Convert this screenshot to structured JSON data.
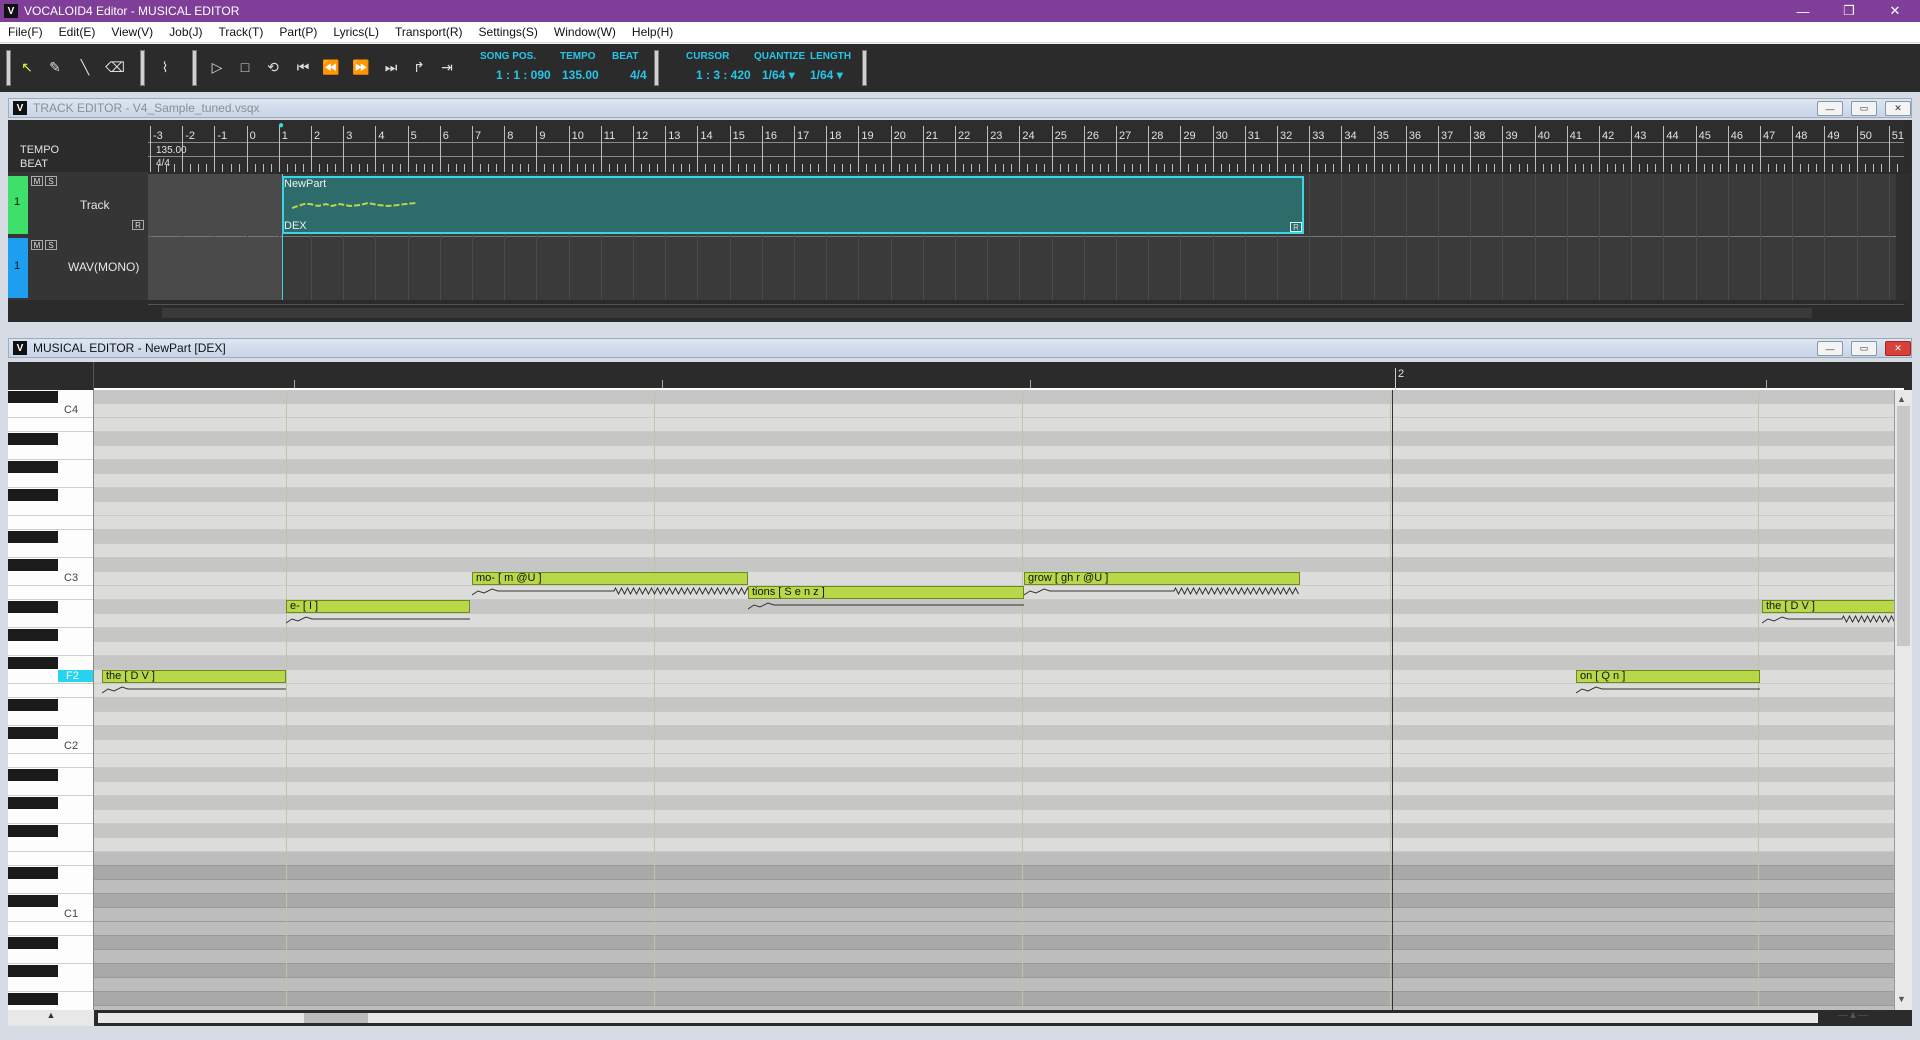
{
  "window": {
    "title": "VOCALOID4 Editor - MUSICAL EDITOR",
    "logo": "V",
    "controls": [
      "minimize-icon",
      "restore-icon",
      "close-icon"
    ]
  },
  "menu": [
    "File(F)",
    "Edit(E)",
    "View(V)",
    "Job(J)",
    "Track(T)",
    "Part(P)",
    "Lyrics(L)",
    "Transport(R)",
    "Settings(S)",
    "Window(W)",
    "Help(H)"
  ],
  "toolbar": {
    "tools": [
      "arrow-tool-icon",
      "pencil-tool-icon",
      "line-tool-icon",
      "eraser-tool-icon",
      "curve-tool-icon"
    ],
    "transport": [
      "play-icon",
      "stop-icon",
      "loop-icon",
      "start-icon",
      "rewind-icon",
      "forward-icon",
      "end-icon",
      "start-marker-icon",
      "end-marker-icon"
    ],
    "song_pos_label": "SONG POS.",
    "song_pos": "1 : 1 : 090",
    "tempo_label": "TEMPO",
    "tempo": "135.00",
    "beat_label": "BEAT",
    "beat": "4/4",
    "cursor_label": "CURSOR",
    "cursor": "1 : 3 : 420",
    "quantize_label": "QUANTIZE",
    "quantize": "1/64 ▾",
    "length_label": "LENGTH",
    "length": "1/64 ▾",
    "accent": "#26c6e8"
  },
  "track_editor": {
    "title": "TRACK EDITOR - V4_Sample_tuned.vsqx",
    "tempo_label": "TEMPO",
    "tempo_value": "135.00",
    "beat_label": "BEAT",
    "beat_value": "4/4",
    "measures": [
      "-3",
      "-2",
      "-1",
      "0",
      "1",
      "2",
      "3",
      "4",
      "5",
      "6",
      "7",
      "8",
      "9",
      "10",
      "11",
      "12",
      "13",
      "14",
      "15",
      "16",
      "17",
      "18",
      "19",
      "20",
      "21",
      "22",
      "23",
      "24",
      "25",
      "26",
      "27",
      "28",
      "29",
      "30",
      "31",
      "32",
      "33",
      "34",
      "35",
      "36",
      "37",
      "38",
      "39",
      "40",
      "41",
      "42",
      "43",
      "44",
      "45",
      "46",
      "47",
      "48",
      "49",
      "50",
      "51"
    ],
    "tracks": [
      {
        "num": "1",
        "name": "Track",
        "color": "#3fe06a",
        "m": "M",
        "s": "S"
      },
      {
        "num": "1",
        "name": "WAV(MONO)",
        "color": "#1e9ef0",
        "m": "M",
        "s": "S"
      }
    ],
    "part": {
      "name": "NewPart",
      "singer": "DEX",
      "r": "R",
      "color": "#2e6b6b",
      "border": "#3ad6e6"
    }
  },
  "musical_editor": {
    "title": "MUSICAL EDITOR - NewPart [DEX]",
    "measure_marker": "2",
    "key_labels": [
      {
        "text": "C4"
      },
      {
        "text": "C3"
      },
      {
        "text": "F2",
        "highlight": true
      },
      {
        "text": "C2"
      },
      {
        "text": "C1"
      }
    ],
    "notes": [
      {
        "lyric": "the [ D V ]"
      },
      {
        "lyric": "e- [ I ]"
      },
      {
        "lyric": "mo- [ m @U ]"
      },
      {
        "lyric": "tions [ S e n z ]"
      },
      {
        "lyric": "grow [ gh r @U ]"
      },
      {
        "lyric": "on [ Q n ]"
      },
      {
        "lyric": "the [ D V ]"
      }
    ],
    "note_color": "#b8d84a"
  }
}
